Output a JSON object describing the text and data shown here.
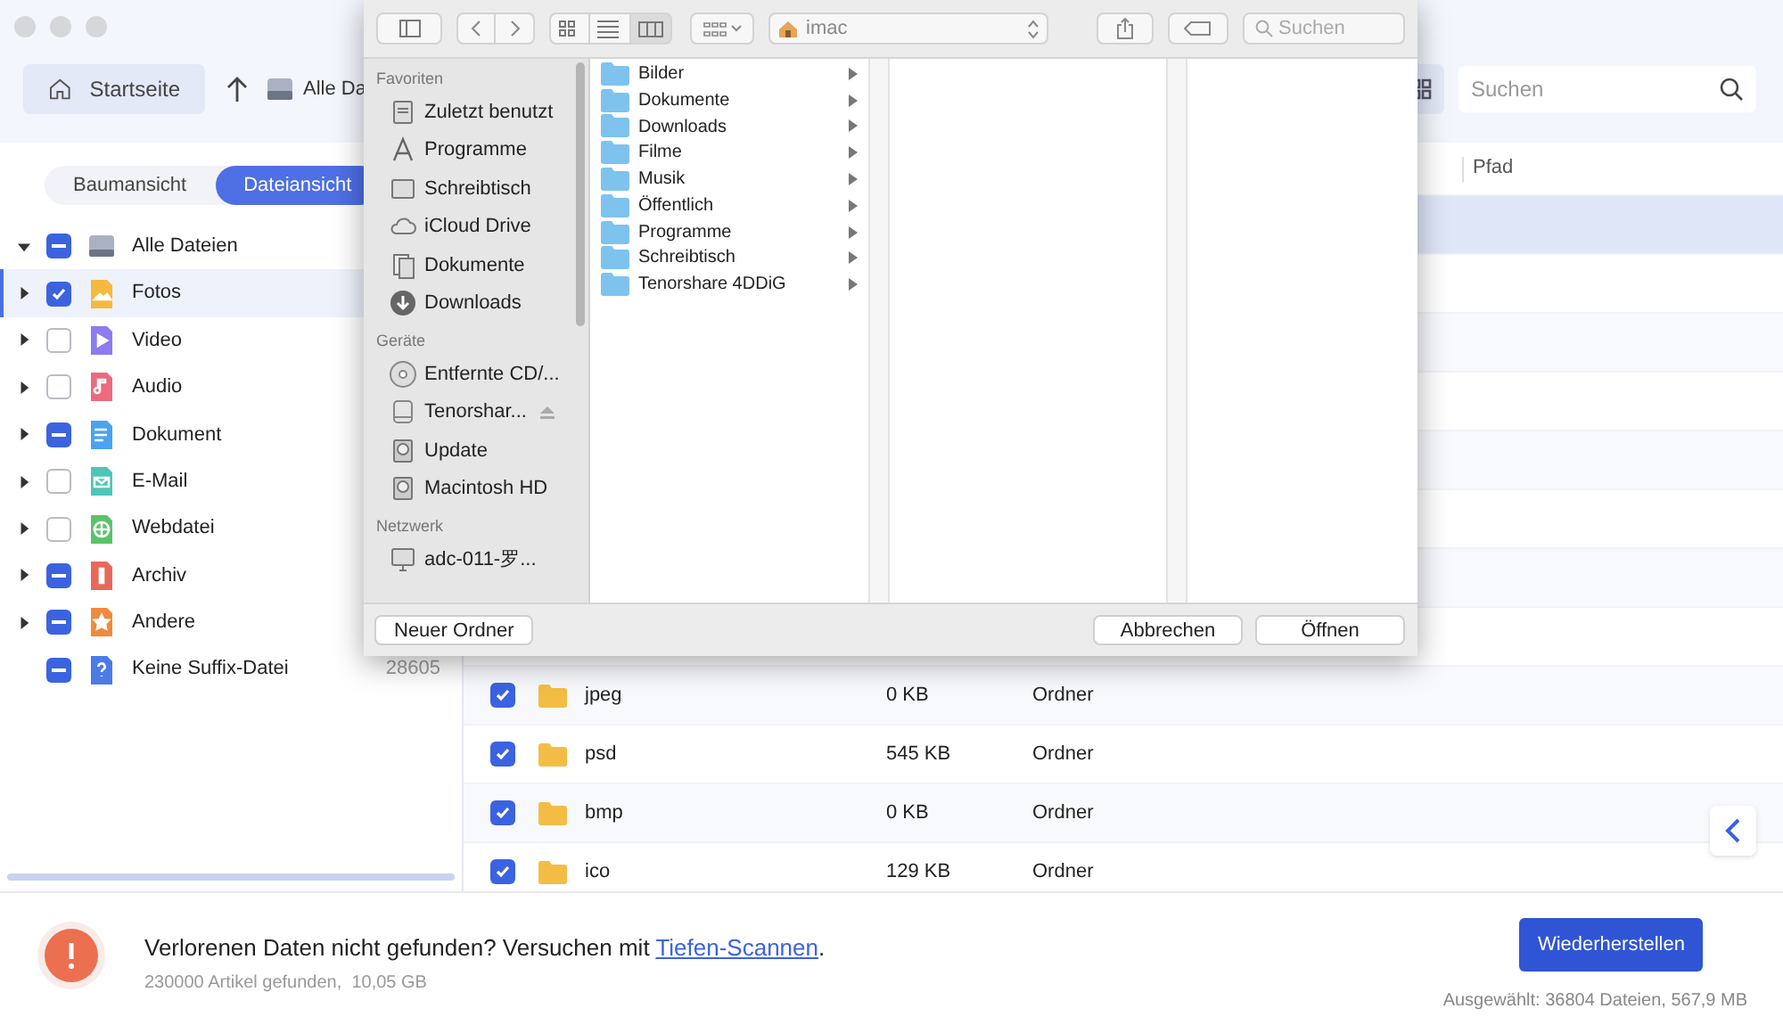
{
  "nav": {
    "home": "Startseite",
    "breadcrumb": "Alle Da",
    "search": {
      "placeholder": "Suchen"
    }
  },
  "view_tabs": [
    {
      "label": "Baumansicht",
      "selected": false
    },
    {
      "label": "Dateiansicht",
      "selected": true
    }
  ],
  "tree": [
    {
      "label": "Alle Dateien",
      "kind": "drive",
      "checked": true,
      "partial": true,
      "expanded": true,
      "selected": false,
      "children": [
        {
          "label": "Fotos",
          "kind": "photo",
          "color": "#f5b93e",
          "checked": true,
          "partial": false,
          "expanded": false,
          "selected": true
        },
        {
          "label": "Video",
          "kind": "video",
          "color": "#8b7cf0",
          "checked": false,
          "partial": false,
          "expanded": false,
          "selected": false
        },
        {
          "label": "Audio",
          "kind": "audio",
          "color": "#ec6a7d",
          "checked": false,
          "partial": false,
          "expanded": false,
          "selected": false
        },
        {
          "label": "Dokument",
          "kind": "doc",
          "color": "#4aa3f0",
          "checked": true,
          "partial": true,
          "expanded": false,
          "selected": false
        },
        {
          "label": "E-Mail",
          "kind": "mail",
          "color": "#4cc6b8",
          "checked": false,
          "partial": false,
          "expanded": false,
          "selected": false
        },
        {
          "label": "Webdatei",
          "kind": "web",
          "color": "#5cc26a",
          "checked": false,
          "partial": false,
          "expanded": false,
          "selected": false
        },
        {
          "label": "Archiv",
          "kind": "archive",
          "color": "#e8695a",
          "checked": true,
          "partial": true,
          "expanded": false,
          "selected": false
        },
        {
          "label": "Andere",
          "kind": "other",
          "color": "#f08a3c",
          "checked": true,
          "partial": true,
          "expanded": false,
          "selected": false
        },
        {
          "label": "Keine Suffix-Datei",
          "kind": "unknown",
          "color": "#4b7be8",
          "checked": true,
          "partial": true,
          "count": "28605",
          "selected": false
        }
      ]
    }
  ],
  "table": {
    "columns": [
      {
        "label": "Pfad"
      }
    ],
    "rows": [
      {
        "selected": true
      },
      {
        "selected": false
      },
      {
        "selected": false
      },
      {
        "selected": false
      },
      {
        "selected": false
      },
      {
        "selected": false
      },
      {
        "selected": false
      },
      {
        "selected": false
      },
      {
        "selected": false,
        "checked": true,
        "name": "jpeg",
        "size": "0 KB",
        "type": "Ordner"
      },
      {
        "selected": false,
        "checked": true,
        "name": "psd",
        "size": "545 KB",
        "type": "Ordner"
      },
      {
        "selected": false,
        "checked": true,
        "name": "bmp",
        "size": "0 KB",
        "type": "Ordner"
      },
      {
        "selected": false,
        "checked": true,
        "name": "ico",
        "size": "129 KB",
        "type": "Ordner"
      }
    ]
  },
  "footer": {
    "message": "Verlorenen Daten nicht gefunden? Versuchen mit",
    "link": "Tiefen-Scannen",
    "after": ".",
    "summary": "230000 Artikel gefunden,  10,05 GB",
    "button": "Wiederherstellen",
    "selection": "Ausgewählt: 36804 Dateien, 567,9 MB"
  },
  "dialog": {
    "views": [
      {
        "kind": "icons",
        "selected": false
      },
      {
        "kind": "list",
        "selected": false
      },
      {
        "kind": "columns",
        "selected": true
      }
    ],
    "location": "imac",
    "search": {
      "placeholder": "Suchen"
    },
    "sidebar": [
      {
        "heading": "Favoriten",
        "items": [
          {
            "label": "Zuletzt benutzt",
            "kind": "recent"
          },
          {
            "label": "Programme",
            "kind": "apps"
          },
          {
            "label": "Schreibtisch",
            "kind": "desktop"
          },
          {
            "label": "iCloud Drive",
            "kind": "cloud"
          },
          {
            "label": "Dokumente",
            "kind": "docs"
          },
          {
            "label": "Downloads",
            "kind": "download"
          }
        ]
      },
      {
        "heading": "Geräte",
        "items": [
          {
            "label": "Entfernte CD/...",
            "kind": "disc"
          },
          {
            "label": "Tenorshar...",
            "kind": "disk",
            "eject": true
          },
          {
            "label": "Update",
            "kind": "hd"
          },
          {
            "label": "Macintosh HD",
            "kind": "hd"
          }
        ]
      },
      {
        "heading": "Netzwerk",
        "items": [
          {
            "label": "adc-011-罗...",
            "kind": "computer"
          }
        ]
      }
    ],
    "folders": [
      "Bilder",
      "Dokumente",
      "Downloads",
      "Filme",
      "Musik",
      "Öffentlich",
      "Programme",
      "Schreibtisch",
      "Tenorshare 4DDiG"
    ],
    "buttons": {
      "new_folder": "Neuer Ordner",
      "cancel": "Abbrechen",
      "open": "Öffnen"
    }
  }
}
